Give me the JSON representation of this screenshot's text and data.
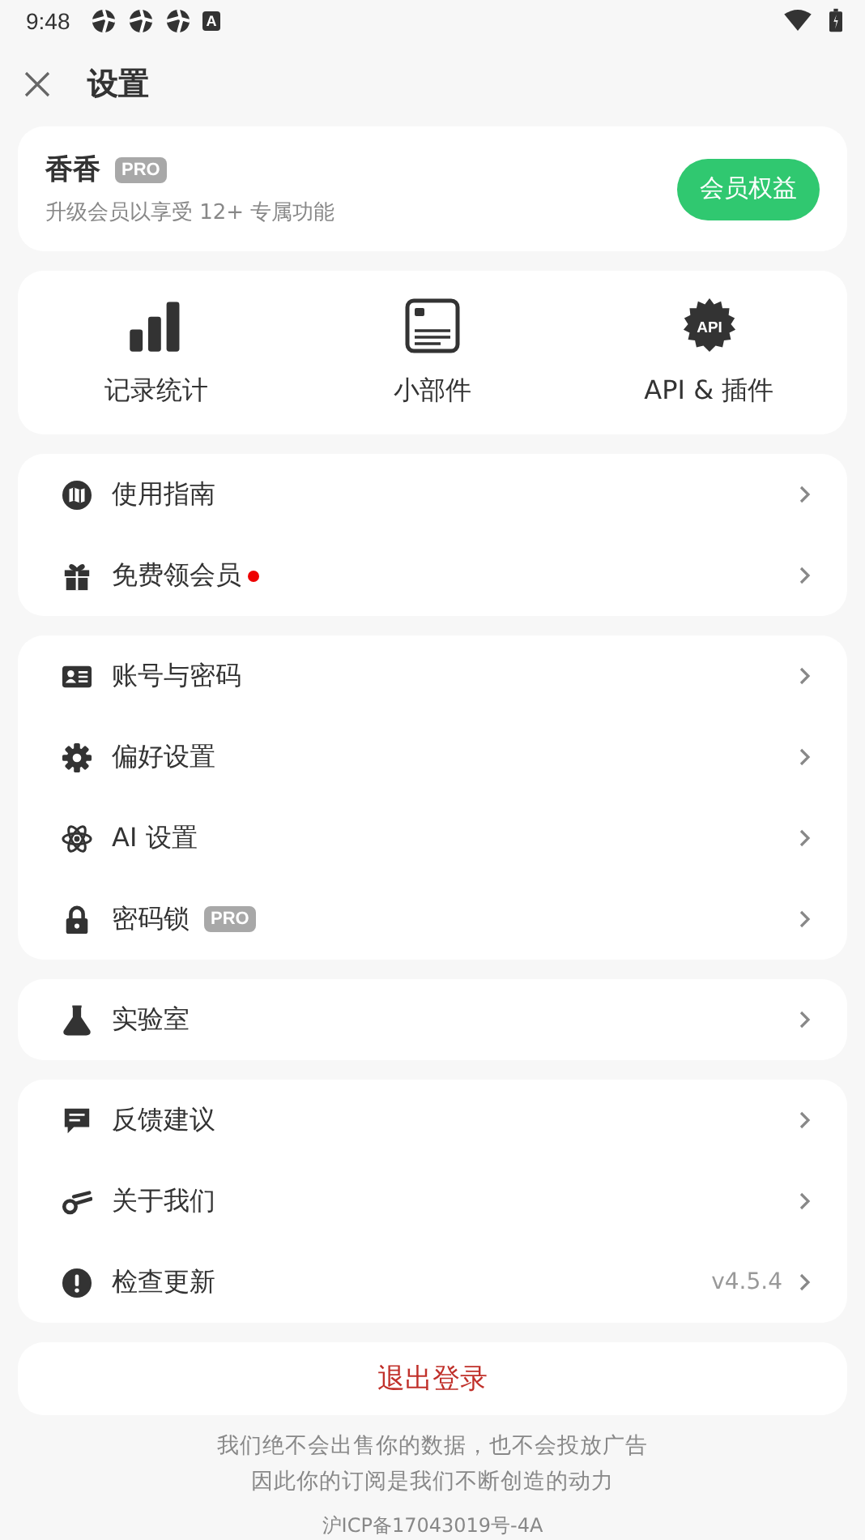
{
  "status_bar": {
    "time": "9:48",
    "notification_letter": "A"
  },
  "header": {
    "title": "设置"
  },
  "account": {
    "name": "香香",
    "badge": "PRO",
    "subtitle": "升级会员以享受 12+ 专属功能",
    "button": "会员权益"
  },
  "shortcuts": [
    {
      "label": "记录统计"
    },
    {
      "label": "小部件"
    },
    {
      "label": "API & 插件",
      "icon_text": "API"
    }
  ],
  "groups": [
    {
      "items": [
        {
          "label": "使用指南"
        },
        {
          "label": "免费领会员",
          "new_dot": true
        }
      ]
    },
    {
      "items": [
        {
          "label": "账号与密码"
        },
        {
          "label": "偏好设置"
        },
        {
          "label": "AI 设置"
        },
        {
          "label": "密码锁",
          "badge": "PRO"
        }
      ]
    },
    {
      "items": [
        {
          "label": "实验室"
        }
      ]
    },
    {
      "items": [
        {
          "label": "反馈建议"
        },
        {
          "label": "关于我们"
        },
        {
          "label": "检查更新",
          "value": "v4.5.4"
        }
      ]
    }
  ],
  "logout": "退出登录",
  "footer": {
    "lines": [
      "我们绝不会出售你的数据，也不会投放广告",
      "因此你的订阅是我们不断创造的动力"
    ],
    "icp": "沪ICP备17043019号-4A"
  }
}
